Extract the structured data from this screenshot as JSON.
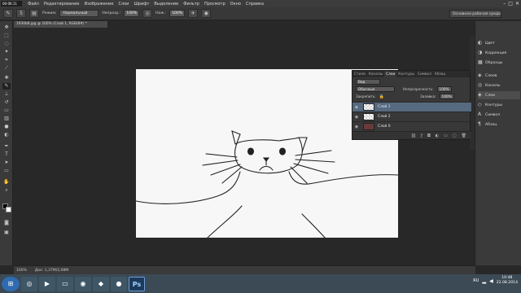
{
  "menubar": {
    "recorder": "00:06:11",
    "items": [
      "Файл",
      "Редактирование",
      "Изображение",
      "Слои",
      "Шрифт",
      "Выделение",
      "Фильтр",
      "Просмотр",
      "Окно",
      "Справка"
    ],
    "window_controls": [
      "–",
      "□",
      "✕"
    ]
  },
  "options": {
    "tool_preset_icon": "brush-preset-icon",
    "size": "5",
    "mode_label": "Режим:",
    "mode_value": "Нормальный",
    "opacity_label": "Непрозр.:",
    "opacity_value": "100%",
    "flow_label": "Наж.:",
    "flow_value": "100%",
    "workspace": "Основная рабочая среда"
  },
  "document": {
    "tab_title": "1930b8.jpg @ 100% (Слой 1, RGB/8#) *",
    "status_zoom": "100%",
    "status_doc": "Док: 1,37M/2,08M",
    "canvas_bg": "#f7f7f7"
  },
  "dock": {
    "items": [
      {
        "icon": "color-icon",
        "label": "Цвет"
      },
      {
        "icon": "adjustments-icon",
        "label": "Коррекция"
      },
      {
        "icon": "samples-icon",
        "label": "Образцы"
      },
      {
        "icon": "layers-icon",
        "label": "Слоев"
      },
      {
        "icon": "channels-icon",
        "label": "Каналы"
      },
      {
        "icon": "layers-icon",
        "label": "Слои"
      },
      {
        "icon": "paths-icon",
        "label": "Контуры"
      },
      {
        "icon": "symbols-icon",
        "label": "Символ"
      },
      {
        "icon": "paragraph-icon",
        "label": "Абзац"
      }
    ]
  },
  "layers_panel": {
    "tabs": [
      "Стили",
      "Каналы",
      "Слои",
      "Контуры",
      "Символ",
      "Абзац"
    ],
    "active_tab": "Слои",
    "filter_value": "Вид",
    "blend_value": "Обычные",
    "opacity_label": "Непрозрачность:",
    "opacity_value": "100%",
    "lock_label": "Закрепить:",
    "fill_label": "Заливка:",
    "fill_value": "100%",
    "layers": [
      {
        "name": "Слой 1",
        "selected": true
      },
      {
        "name": "Слой 2",
        "selected": false
      },
      {
        "name": "Слой 0",
        "selected": false
      }
    ]
  },
  "taskbar": {
    "apps": [
      "start-orb",
      "browser-icon",
      "media-player-icon",
      "explorer-icon",
      "chrome-icon",
      "app-icon",
      "recorder-icon",
      "photoshop-icon"
    ],
    "ps_label": "Ps",
    "lang": "RU",
    "time": "10:48",
    "date": "22.08.2014"
  }
}
